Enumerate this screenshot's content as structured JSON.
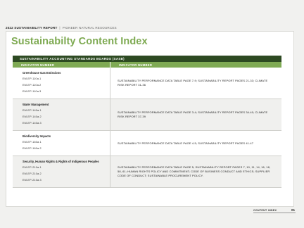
{
  "header": {
    "report": "2022 SUSTAINABILITY REPORT",
    "separator": "|",
    "organization": "PIONEER NATURAL RESOURCES"
  },
  "title": "Sustainabilty Content Index",
  "table": {
    "band": "SUSTAINABILITY ACCOUNTING STANDARDS BOARDS (SASB)",
    "col1_header": "INDICATOR NUMBER",
    "col2_header": "INDICATOR NUMBER",
    "rows": [
      {
        "category": "Greenhouse Gas Emissions",
        "codes": [
          "EM-EP-110a.1",
          "EM-EP-110a.2",
          "EM-EP-110a.3"
        ],
        "reference": "SUSTAINABILITY PERFORMANCE DATA TABLE PAGE 7-9; SUSTAINABILITY REPORT PAGES 21-33; CLIMATE RISK REPORT 31-36"
      },
      {
        "category": "Water Management",
        "codes": [
          "EM-EP-140a.1",
          "EM-EP-140a.2",
          "EM-EP-140a.3"
        ],
        "reference": "SUSTAINABILITY PERFORMANCE DATA TABLE PAGE 3-4; SUSTAINABILITY REPORT PAGES 34-40; CLIMATE RISK REPORT 37-39"
      },
      {
        "category": "Biodiversity Impacts",
        "codes": [
          "EM-EP-160a.1",
          "EM-EP-160a.2"
        ],
        "reference": "SUSTAINABILITY PERFORMANCE DATA TABLE PAGE 4-5; SUSTAINABILITY REPORT PAGES 41-47"
      },
      {
        "category": "Security, Human Rights & Rights of Indigenous Peoples",
        "codes": [
          "EM-EP-210a.1",
          "EM-EP-210a.2",
          "EM-EP-210a.3"
        ],
        "reference": "SUSTAINABILITY PERFORMANCE DATA TABLE PAGE 5; SUSTAINABILITY REPORT PAGES 7, 10, 11, 14, 16, 18, 58, 61; HUMAN RIGHTS POLICY AND COMMITMENT; CODE OF BUSINESS CONDUCT AND ETHICS; SUPPLIER CODE OF CONDUCT; SUSTAINABLE PROCUREMENT POLICY."
      }
    ]
  },
  "footer": {
    "section": "CONTENT INDEX",
    "page": "01"
  }
}
